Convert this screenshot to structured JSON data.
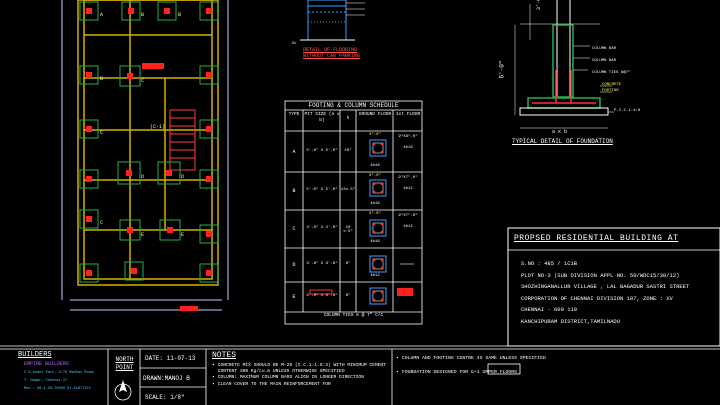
{
  "flooring_detail": {
    "title_line1": "DETAIL OF FLOORING",
    "title_line2": "WITHOUT CAR PARKING"
  },
  "schedule": {
    "title": "FOOTING & COLUMN SCHEDULE",
    "headers": [
      "TYPE",
      "PIT SIZE (a x b)",
      "h",
      "GROUND FLOOR",
      "1st FLOOR"
    ],
    "rows": [
      {
        "type": "A",
        "pit": "5'-0\" X 5'-0\"",
        "h": "18\"",
        "gf_top": "3\"-0\"",
        "gf_bottom": "4#16",
        "ff_top": "9\"X9\"-0\"",
        "ff_bottom": "4#16"
      },
      {
        "type": "B",
        "pit": "5'-0\" X 5'-0\"",
        "h": "13x.5\"",
        "gf_top": "3\"-0\"",
        "gf_bottom": "4#16",
        "ff_top": "9\"X7\"-0\"",
        "ff_bottom": "4#12"
      },
      {
        "type": "C",
        "pit": "4'-0\" X 4'-0\"",
        "h": "10 x.5\"",
        "gf_top": "3\"-0\"",
        "gf_bottom": "4#16",
        "ff_top": "9\"X7\"-0\"",
        "ff_bottom": "4#12"
      },
      {
        "type": "D",
        "pit": "3'-6\" X 3'-6\"",
        "h": "9\"",
        "gf_top": "",
        "gf_bottom": "4#12",
        "ff_top": "",
        "ff_bottom": ""
      },
      {
        "type": "E",
        "pit": "3'-0\" X 3'-0\"",
        "h": "8\"",
        "gf_top": "",
        "gf_bottom": "",
        "ff_top": "",
        "ff_bottom": ""
      }
    ],
    "footer": "COLUMN TIES 8 @ 7\" C/C"
  },
  "foundation": {
    "caption": "TYPICAL DETAIL OF FOUNDATION",
    "labels": [
      "COLUMN BAR",
      "COLUMN BAR",
      "COLUMN TIES 8@7\"",
      "CONCRETE",
      "FOOTING",
      "P.C.C 1:4:8"
    ],
    "height_label": "6'-0\"",
    "width_label": "a x b"
  },
  "building": {
    "heading": "PROPSED RESIDENTIAL BUILDING AT",
    "lines": [
      "S.NO : 485 / 1C1B",
      "PLOT NO-3 (SUB DIVISION APPL NO. 50/WDC15/38/12)",
      "SHOZHINGANALLUR VILLAGE , LAL BAGADUR SASTRI STREET",
      "CORPORATION OF CHENNAI DIVISION 187, ZONE : XV",
      "CHENNAI - 600 119",
      "KANCHIPURAM DISTRICT,TAMILNADU"
    ]
  },
  "title_block": {
    "builders_label": "BUILDERS",
    "builder_name": "EMPIRE BUILDERS",
    "builder_lines": [
      "C 9,Anant Park, 3/76 Madhav Road,",
      "T. Nagar, Chennai-17",
      "Mob : 98-4-58-76060 87-01877321"
    ],
    "north_label": "NORTH",
    "point_label": "POINT",
    "date_label": "DATE: 11-07-13",
    "drawn_label": "DRAWN:MANOJ B",
    "scale_label": "SCALE: 1/8\"",
    "notes_heading": "NOTES",
    "notes": [
      "CONCRETE MIX SHOULD BE M-20 (C.C.1:1.5:3) WITH MINIMUM CEMENT CONTENT 300 Kg/cu.m UNLESS OTHERWISE SPECIFIED",
      "COLUMN: MAXIMUM COLUMN BARS ALIGN IN LONGER DIRECTION",
      "CLEAR COVER TO THE MAIN REINFORCEMENT FOR"
    ],
    "notes_right": [
      "COLUMN AND FOOTING CENTRE IS SAME UNLESS SPECIFIED",
      "FOUNDATION DESIGNED FOR G+1 UPPER FLOORS"
    ]
  }
}
